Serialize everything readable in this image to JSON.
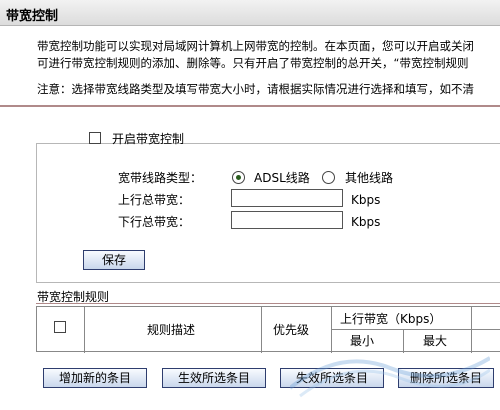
{
  "page": {
    "title": "带宽控制"
  },
  "intro": {
    "line1": "带宽控制功能可以实现对局域网计算机上网带宽的控制。在本页面，您可以开启或关闭",
    "line2": "可进行带宽控制规则的添加、删除等。只有开启了带宽控制的总开关，“带宽控制规则",
    "note": "注意：选择带宽线路类型及填写带宽大小时，请根据实际情况进行选择和填写，如不清"
  },
  "settings": {
    "enable_label": "开启带宽控制",
    "enable_checked": false,
    "line_type_label": "宽带线路类型：",
    "line_options": [
      {
        "label": "ADSL线路",
        "checked": true
      },
      {
        "label": "其他线路",
        "checked": false
      }
    ],
    "upload_label": "上行总带宽：",
    "upload_value": "",
    "upload_unit": "Kbps",
    "download_label": "下行总带宽：",
    "download_value": "",
    "download_unit": "Kbps",
    "save_label": "保存"
  },
  "rules": {
    "title": "带宽控制规则",
    "columns": {
      "desc": "规则描述",
      "priority": "优先级",
      "upload_group": "上行带宽（Kbps）",
      "min": "最小",
      "max": "最大"
    }
  },
  "actions": {
    "add": "增加新的条目",
    "enable": "生效所选条目",
    "disable": "失效所选条目",
    "delete": "删除所选条目"
  },
  "colors": {
    "title_bar": "#dcdcdc",
    "divider": "#b08a8a",
    "button_border": "#2e3d6e"
  }
}
